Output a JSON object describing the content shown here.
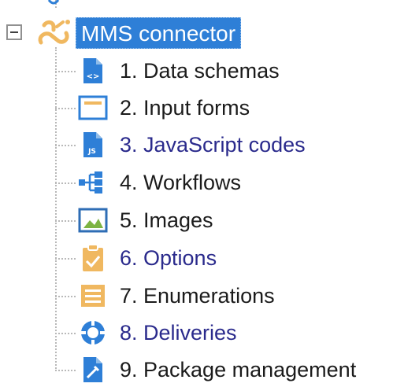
{
  "tree": {
    "root": {
      "label": "MMS connector",
      "selected": true,
      "expanded": true,
      "icon": "connector-icon",
      "selection_color": "#2e7fd7"
    },
    "children": [
      {
        "label": "1. Data schemas",
        "icon": "data-schema-icon",
        "style": "normal"
      },
      {
        "label": "2. Input forms",
        "icon": "input-form-icon",
        "style": "normal"
      },
      {
        "label": "3. JavaScript codes",
        "icon": "javascript-file-icon",
        "style": "link"
      },
      {
        "label": "4. Workflows",
        "icon": "workflow-icon",
        "style": "normal"
      },
      {
        "label": "5. Images",
        "icon": "image-icon",
        "style": "normal"
      },
      {
        "label": "6. Options",
        "icon": "options-clipboard-icon",
        "style": "link"
      },
      {
        "label": "7. Enumerations",
        "icon": "enumeration-list-icon",
        "style": "normal"
      },
      {
        "label": "8. Deliveries",
        "icon": "delivery-icon",
        "style": "link"
      },
      {
        "label": "9. Package management",
        "icon": "package-management-icon",
        "style": "normal"
      }
    ]
  }
}
